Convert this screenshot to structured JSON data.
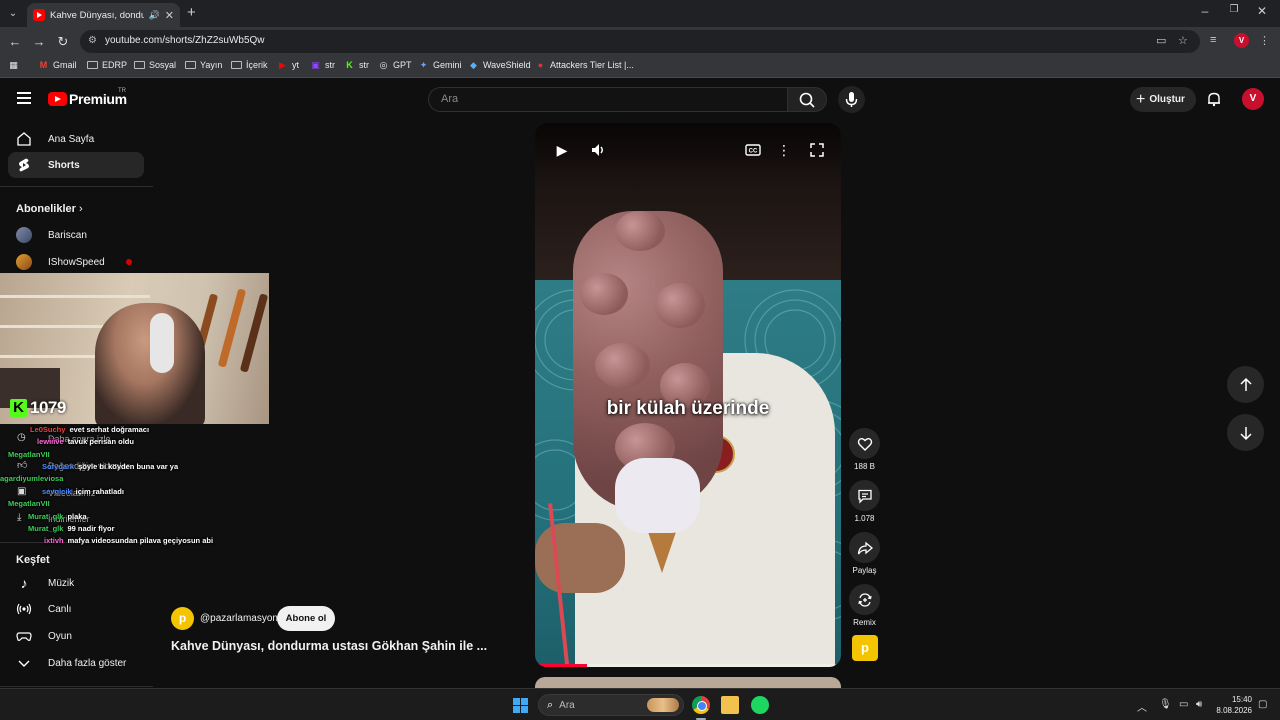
{
  "browser": {
    "tab_title": "Kahve Dünyası, dondurma u",
    "url": "youtube.com/shorts/ZhZ2suWb5Qw",
    "bookmarks": [
      "Gmail",
      "EDRP",
      "Sosyal",
      "Yayın",
      "İçerik",
      "yt",
      "str",
      "str",
      "GPT",
      "Gemini",
      "WaveShield",
      "Attackers Tier List |..."
    ]
  },
  "header": {
    "logo_text": "Premium",
    "country_code": "TR",
    "search_placeholder": "Ara",
    "create_label": "Oluştur",
    "avatar_letter": "V"
  },
  "sidebar": {
    "home": "Ana Sayfa",
    "shorts": "Shorts",
    "subscriptions_header": "Abonelikler",
    "subscriptions": [
      "Bariscan",
      "IShowSpeed"
    ],
    "explore_header": "Keşfet",
    "explore": [
      "Müzik",
      "Canlı",
      "Oyun",
      "Daha fazla göster"
    ],
    "hidden_items": [
      "Daha sonra izle",
      "Beğendiğim videolar",
      "Videolarınız",
      "İndirilenler"
    ]
  },
  "stream_overlay": {
    "viewer_count": "1079",
    "chat": [
      {
        "user": "Le0Suchy",
        "msg": "evet serhat doğramacı",
        "color": "#ff3b3b"
      },
      {
        "user": "lewiiive",
        "msg": "tavuk perisan oldu",
        "color": "#ff6ad5"
      },
      {
        "user": "MegatlanVII",
        "msg": "",
        "color": "#3ccf5a"
      },
      {
        "user": "Sofydark",
        "msg": "şöyle bi köyden buna var ya",
        "color": "#4f8bff"
      },
      {
        "user": "agardiyumleviosa",
        "msg": "",
        "color": "#3ccf5a"
      },
      {
        "user": "sevgicik",
        "msg": "içim rahatladı",
        "color": "#4f8bff"
      },
      {
        "user": "MegatlanVII",
        "msg": "",
        "color": "#3ccf5a"
      },
      {
        "user": "Murat_glk",
        "msg": "plaka",
        "color": "#3ccf5a"
      },
      {
        "user": "Murat_glk",
        "msg": "99 nadir flyor",
        "color": "#3ccf5a"
      },
      {
        "user": "ixtivh",
        "msg": "mafya videosundan pilava geçiyosun abi",
        "color": "#ff6ad5"
      }
    ]
  },
  "video": {
    "caption": "bir külah üzerinde",
    "progress": 0.17,
    "next_up": true
  },
  "actions": {
    "like_count": "188 B",
    "comment_count": "1.078",
    "share_label": "Paylaş",
    "remix_label": "Remix"
  },
  "channel": {
    "handle": "@pazarlamasyon",
    "subscribe_label": "Abone ol",
    "title": "Kahve Dünyası, dondurma ustası Gökhan Şahin ile ..."
  },
  "taskbar": {
    "search_placeholder": "Ara",
    "time": "15:40",
    "date": "8.08.2026"
  }
}
